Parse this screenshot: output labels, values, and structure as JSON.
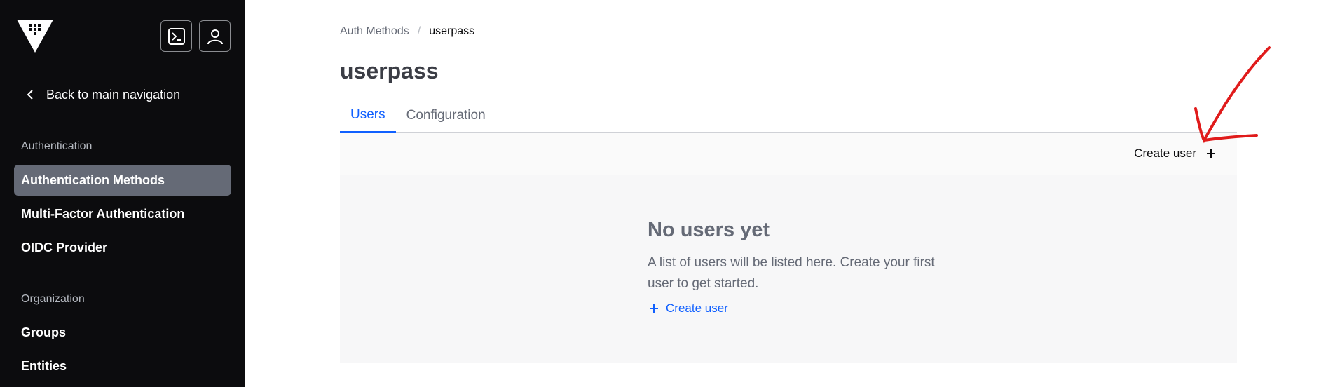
{
  "sidebar": {
    "back_label": "Back to main navigation",
    "sections": [
      {
        "title": "Authentication"
      },
      {
        "title": "Organization"
      }
    ],
    "items": [
      {
        "label": "Authentication Methods",
        "active": true
      },
      {
        "label": "Multi-Factor Authentication"
      },
      {
        "label": "OIDC Provider"
      },
      {
        "label": "Groups"
      },
      {
        "label": "Entities"
      }
    ]
  },
  "header_icons": [
    "console-icon",
    "user-icon"
  ],
  "breadcrumb": [
    {
      "label": "Auth Methods"
    },
    {
      "label": "userpass"
    }
  ],
  "page": {
    "title": "userpass"
  },
  "tabs": [
    {
      "label": "Users",
      "active": true
    },
    {
      "label": "Configuration"
    }
  ],
  "toolbar": {
    "create_user_label": "Create user"
  },
  "empty_state": {
    "title": "No users yet",
    "message": "A list of users will be listed here. Create your first user to get started.",
    "link_label": "Create user"
  },
  "colors": {
    "sidebar_bg": "#0c0c0e",
    "active_item_bg": "#656a76",
    "accent": "#1060ff",
    "annotation": "#e01b1b"
  }
}
